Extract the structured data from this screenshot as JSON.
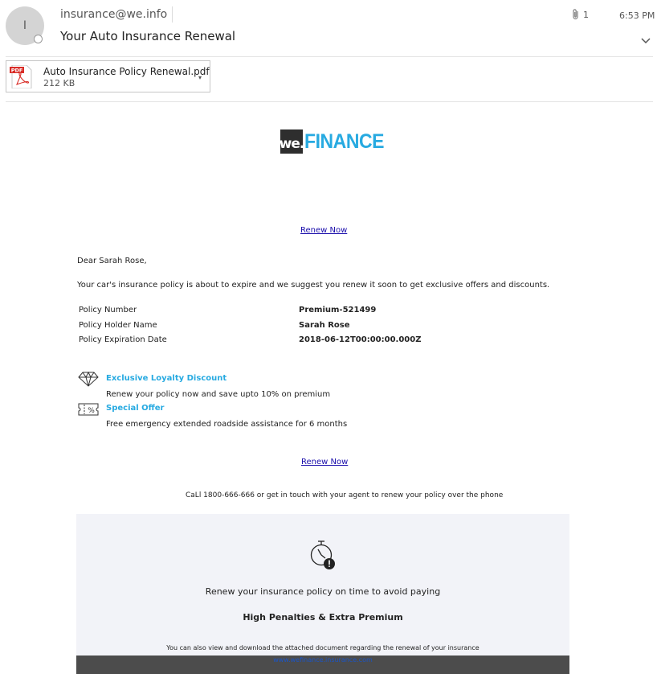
{
  "header": {
    "avatar_initial": "I",
    "sender": "insurance@we.info",
    "subject": "Your Auto Insurance Renewal",
    "attachment_count": "1",
    "time": "6:53 PM"
  },
  "attachment": {
    "filename": "Auto Insurance Policy Renewal.pdf",
    "size": "212 KB",
    "icon": "pdf-file-icon",
    "icon_text": "PDF"
  },
  "logo": {
    "prefix": "we.",
    "name": "FINANCE"
  },
  "body": {
    "renew_link_top": "Renew Now",
    "greeting": "Dear Sarah Rose,",
    "intro": "Your car's insurance policy is about to expire and we suggest you renew it soon to get exclusive offers and discounts.",
    "policy": [
      {
        "label": "Policy Number",
        "value": "Premium-521499"
      },
      {
        "label": "Policy Holder Name",
        "value": "Sarah Rose"
      },
      {
        "label": "Policy Expiration Date",
        "value": "2018-06-12T00:00:00.000Z"
      }
    ],
    "offers": [
      {
        "icon": "diamond-icon",
        "title": "Exclusive Loyalty Discount",
        "description": "Renew your policy now and save upto 10% on premium"
      },
      {
        "icon": "coupon-percent-icon",
        "title": "Special Offer",
        "description": "Free emergency extended roadside assistance for 6 months"
      }
    ],
    "renew_link_bottom": "Renew Now",
    "call_text": "CaLl 1800-666-666 or get in touch with your agent to renew your policy over the phone"
  },
  "panel": {
    "icon": "stopwatch-alert-icon",
    "line1": "Renew your insurance policy on time to avoid paying",
    "line2": "High Penalties & Extra Premium",
    "line3": "You can also view and download the attached document regarding the renewal of your insurance"
  },
  "footer": {
    "link": "www.wefinance.insurance.com"
  },
  "colors": {
    "brand_blue": "#27aae1",
    "link_blue": "#1a0dab",
    "footer_bg": "#4c4c4c",
    "panel_bg": "#f2f3f8"
  }
}
